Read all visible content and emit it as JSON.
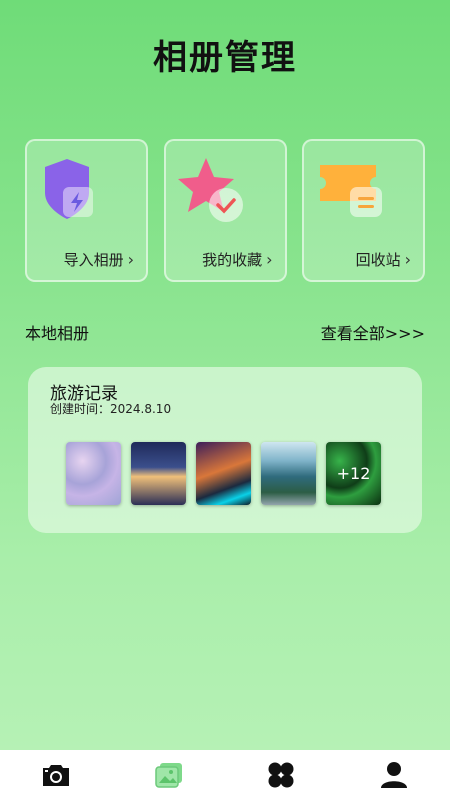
{
  "header": {
    "title": "相册管理"
  },
  "quick_actions": [
    {
      "label": "导入相册",
      "icon": "shield-bolt-icon"
    },
    {
      "label": "我的收藏",
      "icon": "star-check-icon"
    },
    {
      "label": "回收站",
      "icon": "ticket-trash-icon"
    }
  ],
  "section": {
    "title": "本地相册",
    "view_all": "查看全部>>>"
  },
  "album": {
    "name": "旅游记录",
    "created": "创建时间：2024.8.10",
    "more_count": "+12"
  },
  "tabbar": [
    {
      "icon": "camera-icon",
      "active": false
    },
    {
      "icon": "album-icon",
      "active": true
    },
    {
      "icon": "apps-icon",
      "active": false
    },
    {
      "icon": "profile-icon",
      "active": false
    }
  ],
  "colors": {
    "accent": "#6fdc78",
    "active_tab": "#7ed98a"
  }
}
